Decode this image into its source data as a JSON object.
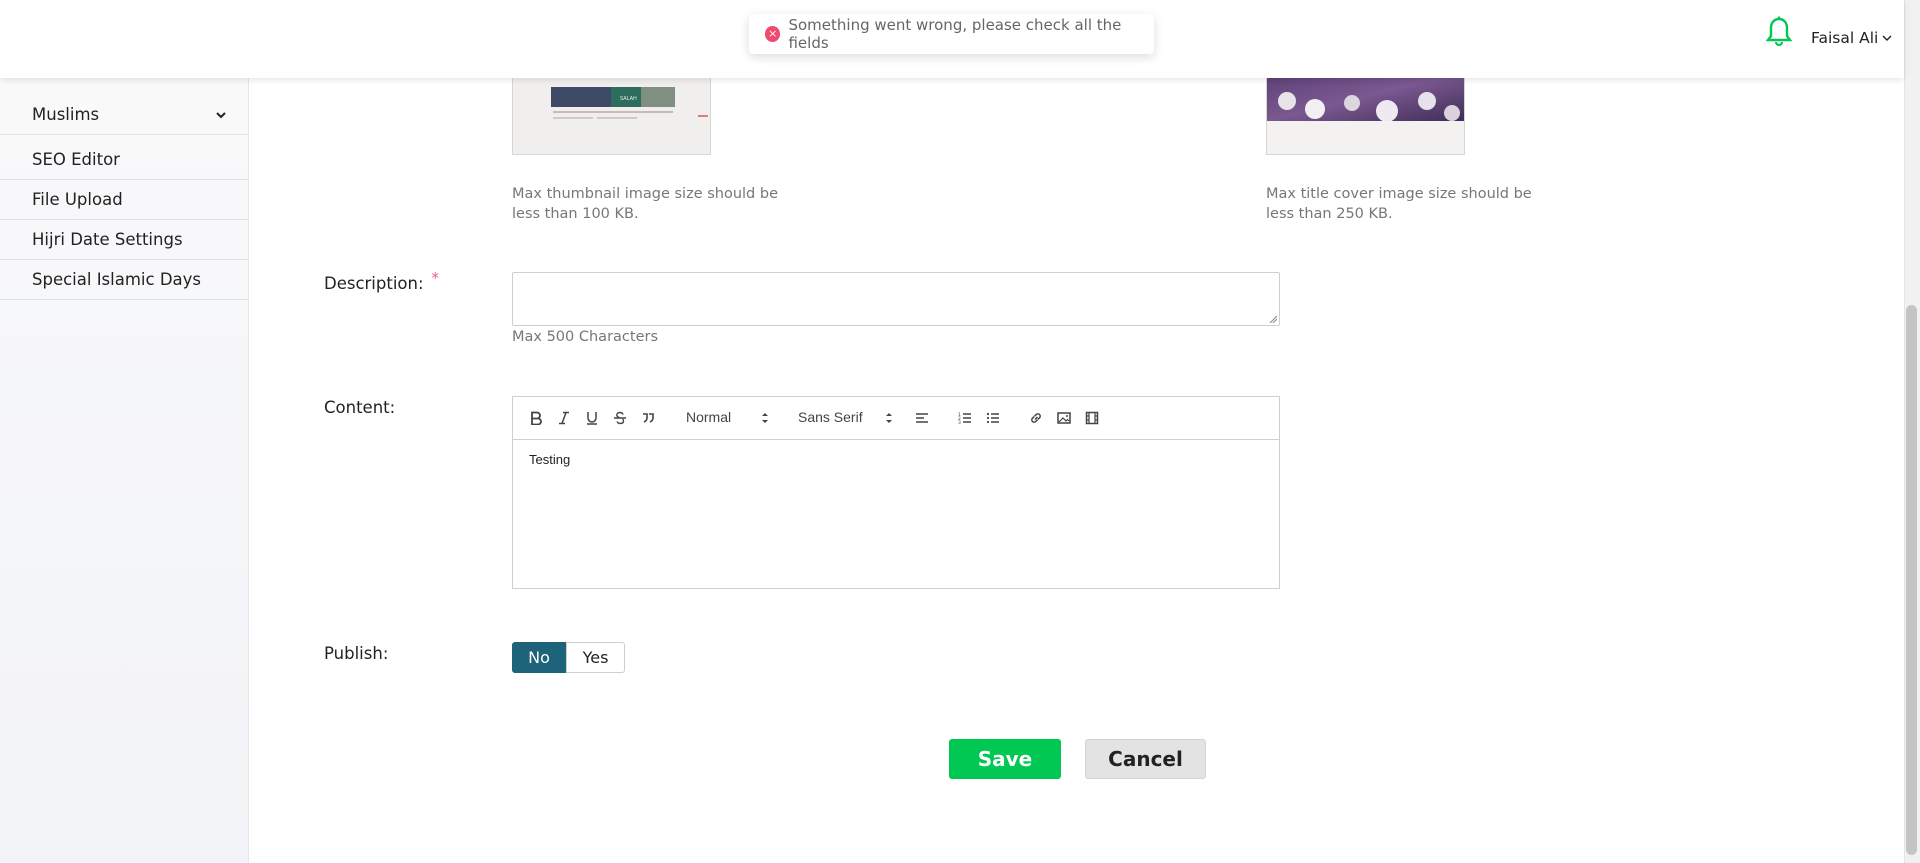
{
  "toast": {
    "message": "Something went wrong, please check all the fields"
  },
  "header": {
    "user_name": "Faisal Ali"
  },
  "sidebar": {
    "items": [
      {
        "label": "Muslims"
      },
      {
        "label": "SEO Editor"
      },
      {
        "label": "File Upload"
      },
      {
        "label": "Hijri Date Settings"
      },
      {
        "label": "Special Islamic Days"
      }
    ]
  },
  "images": {
    "thumbnail_hint": [
      "Max thumbnail image size should be",
      "less than 100 KB."
    ],
    "cover_hint": [
      "Max title cover image size should be",
      "less than 250 KB."
    ],
    "thumb_preview_text": "SALAH"
  },
  "form": {
    "description_label": "Description:",
    "description_required": "*",
    "description_value": "",
    "description_hint": "Max 500 Characters",
    "content_label": "Content:",
    "content_value": "Testing",
    "toolbar": {
      "size_select": "Normal",
      "font_select": "Sans Serif"
    },
    "publish_label": "Publish:",
    "publish_no": "No",
    "publish_yes": "Yes",
    "publish_selected": "No"
  },
  "actions": {
    "save": "Save",
    "cancel": "Cancel"
  },
  "colors": {
    "primary_teal": "#1d6379",
    "save_green": "#00c853",
    "bell_green": "#00c853",
    "error_pink": "#f04a6e"
  }
}
